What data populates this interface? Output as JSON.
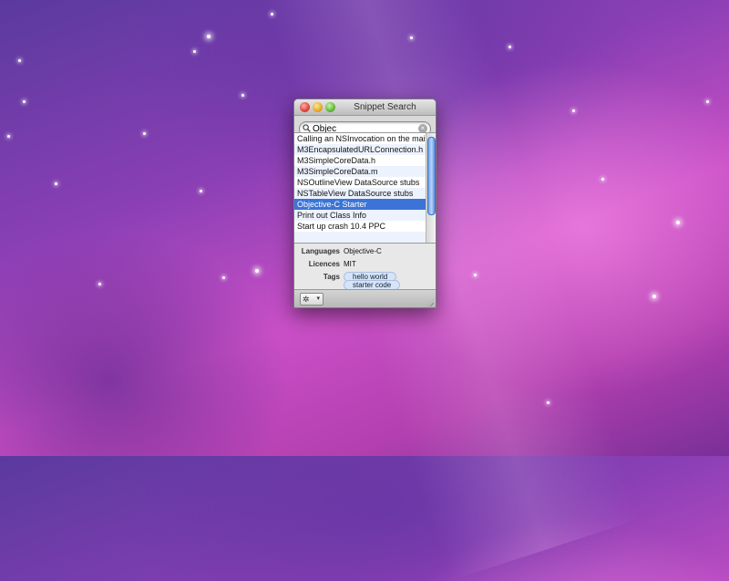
{
  "window": {
    "title": "Snippet Search"
  },
  "search": {
    "value": "Objec",
    "clear_icon": "clear-icon",
    "search_icon": "magnifier-icon"
  },
  "results": {
    "items": [
      "Calling an NSInvocation on the main",
      "M3EncapsulatedURLConnection.h",
      "M3SimpleCoreData.h",
      "M3SimpleCoreData.m",
      "NSOutlineView DataSource stubs",
      "NSTableView DataSource stubs",
      "Objective-C Starter",
      "Print out Class Info",
      "Start up crash 10.4 PPC"
    ],
    "selected_index": 6
  },
  "details": {
    "languages_label": "Languages",
    "languages_value": "Objective-C",
    "licences_label": "Licences",
    "licences_value": "MIT",
    "tags_label": "Tags",
    "tags": [
      "hello world",
      "starter code"
    ]
  },
  "toolbar": {
    "action_icon": "gear-icon",
    "action_glyph": "✲",
    "caret_glyph": "▾"
  },
  "colors": {
    "selection": "#3b74d6",
    "alt_row": "#edf3fe"
  }
}
